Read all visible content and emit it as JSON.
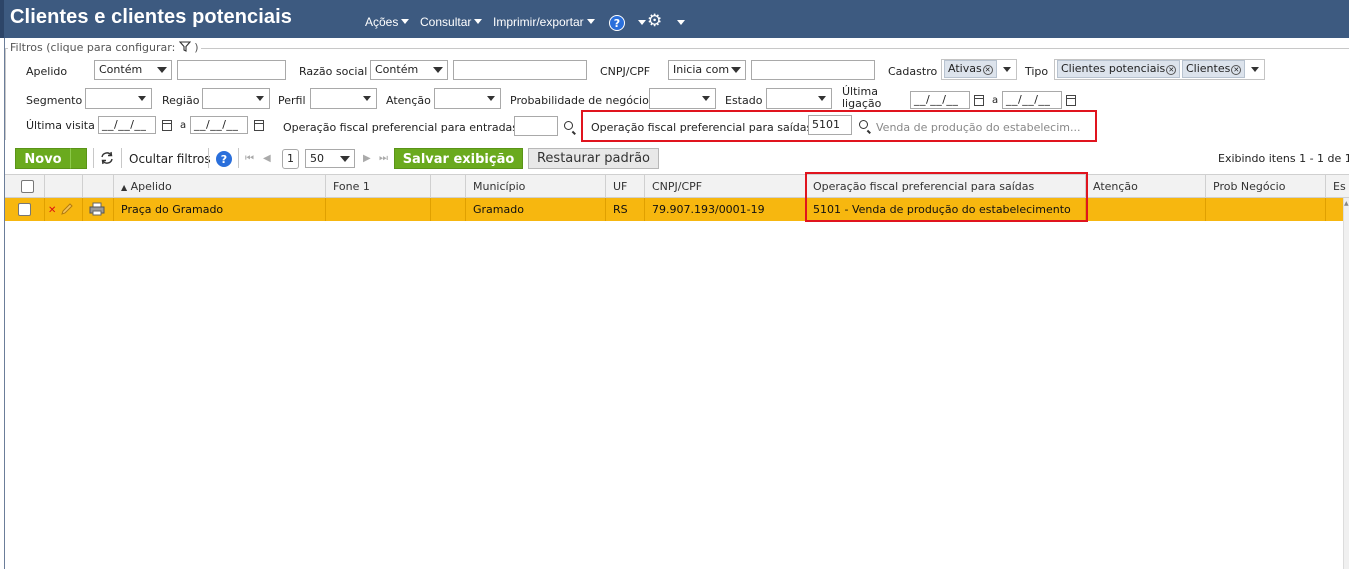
{
  "header": {
    "title": "Clientes e clientes potenciais",
    "menu": [
      "Ações",
      "Consultar",
      "Imprimir/exportar"
    ],
    "help_label": "?"
  },
  "filters": {
    "legend": "Filtros (clique para configurar:",
    "legend_suffix": ")",
    "apelido": {
      "label": "Apelido",
      "mode": "Contém",
      "value": ""
    },
    "razao_social": {
      "label": "Razão social",
      "mode": "Contém",
      "value": ""
    },
    "cnpj": {
      "label": "CNPJ/CPF",
      "mode": "Inicia com",
      "value": ""
    },
    "cadastro": {
      "label": "Cadastro",
      "chips": [
        "Ativas"
      ]
    },
    "tipo": {
      "label": "Tipo",
      "chips": [
        "Clientes potenciais",
        "Clientes"
      ]
    },
    "segmento": {
      "label": "Segmento"
    },
    "regiao": {
      "label": "Região"
    },
    "perfil": {
      "label": "Perfil"
    },
    "atencao": {
      "label": "Atenção"
    },
    "probabilidade": {
      "label": "Probabilidade de negócio"
    },
    "estado": {
      "label": "Estado"
    },
    "ultima_ligacao": {
      "label_1": "Última",
      "label_2": "ligação",
      "from": "__/__/__",
      "sep": "a",
      "to": "__/__/__"
    },
    "ultima_visita": {
      "label": "Última visita",
      "from": "__/__/__",
      "sep": "a",
      "to": "__/__/__"
    },
    "op_entradas": {
      "label": "Operação fiscal preferencial para entradas",
      "value": ""
    },
    "op_saidas": {
      "label": "Operação fiscal preferencial para saídas",
      "value": "5101",
      "description": "Venda de produção do estabelecim..."
    }
  },
  "toolbar": {
    "new_label": "Novo",
    "hide_filters_label": "Ocultar filtros",
    "page": "1",
    "page_size": "50",
    "save_view_label": "Salvar exibição",
    "restore_label": "Restaurar padrão",
    "showing_text": "Exibindo itens 1 - 1 de 1"
  },
  "grid": {
    "columns": [
      "Apelido",
      "Fone 1",
      "",
      "Município",
      "UF",
      "CNPJ/CPF",
      "Operação fiscal preferencial para saídas",
      "Atenção",
      "Prob Negócio",
      "Es"
    ],
    "rows": [
      {
        "apelido": "Praça do Gramado",
        "fone1": "",
        "extra": "",
        "municipio": "Gramado",
        "uf": "RS",
        "cnpj": "79.907.193/0001-19",
        "op_saidas": "5101 - Venda de produção do estabelecimento",
        "atencao": "",
        "prob": ""
      }
    ]
  },
  "colors": {
    "header_bg": "#3d5a80",
    "accent_green": "#6aaa1e",
    "row_highlight": "#f7b70f",
    "highlight_box": "#e0141e"
  }
}
